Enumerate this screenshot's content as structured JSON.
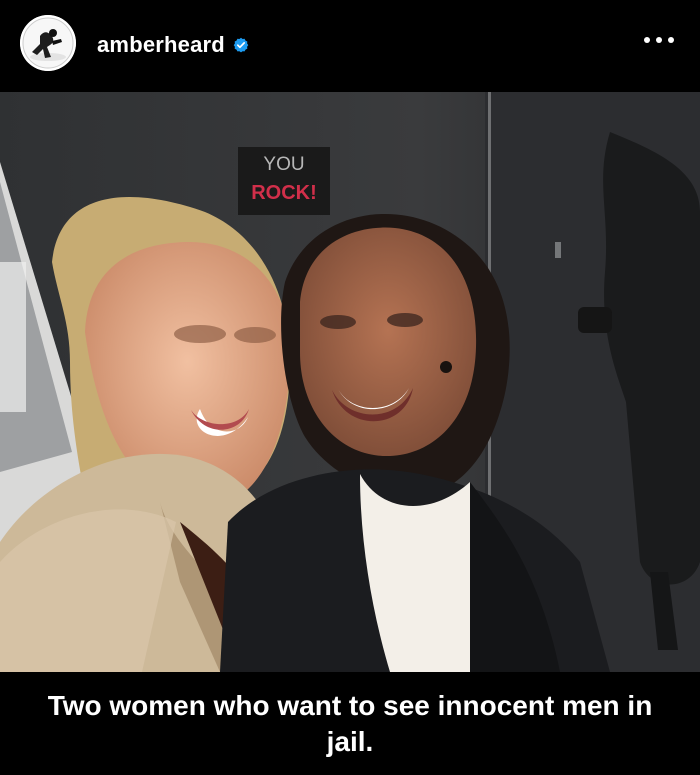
{
  "post": {
    "username": "amberheard",
    "verified_icon": "verified-badge-icon",
    "more_icon": "more-horizontal-icon",
    "avatar_icon": "profile-avatar-icon",
    "photo": {
      "sign_text": [
        "YOU",
        "ROCK!"
      ],
      "sign_color": "#d12f4a"
    },
    "caption": "Two women who want to see innocent men in jail."
  },
  "colors": {
    "background": "#000000",
    "verified": "#1d9bf0",
    "text": "#ffffff"
  }
}
